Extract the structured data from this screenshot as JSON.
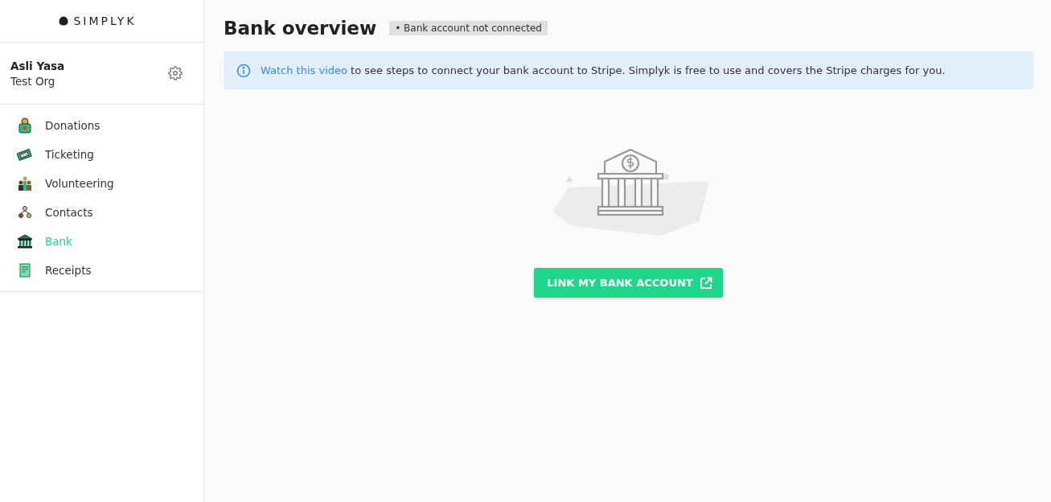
{
  "logo": {
    "text": "SIMPLYK"
  },
  "user": {
    "name": "Asli Yasa",
    "org": "Test Org"
  },
  "nav": [
    {
      "label": "Donations",
      "selected": false
    },
    {
      "label": "Ticketing",
      "selected": false
    },
    {
      "label": "Volunteering",
      "selected": false
    },
    {
      "label": "Contacts",
      "selected": false
    },
    {
      "label": "Bank",
      "selected": true
    },
    {
      "label": "Receipts",
      "selected": false
    }
  ],
  "page": {
    "title": "Bank overview",
    "status_badge": "• Bank account not connected"
  },
  "banner": {
    "link": "Watch this video",
    "text": "to see steps to connect your bank account to Stripe. Simplyk is free to use and covers the Stripe charges for you."
  },
  "button": {
    "label": "LINK MY BANK ACCOUNT"
  }
}
